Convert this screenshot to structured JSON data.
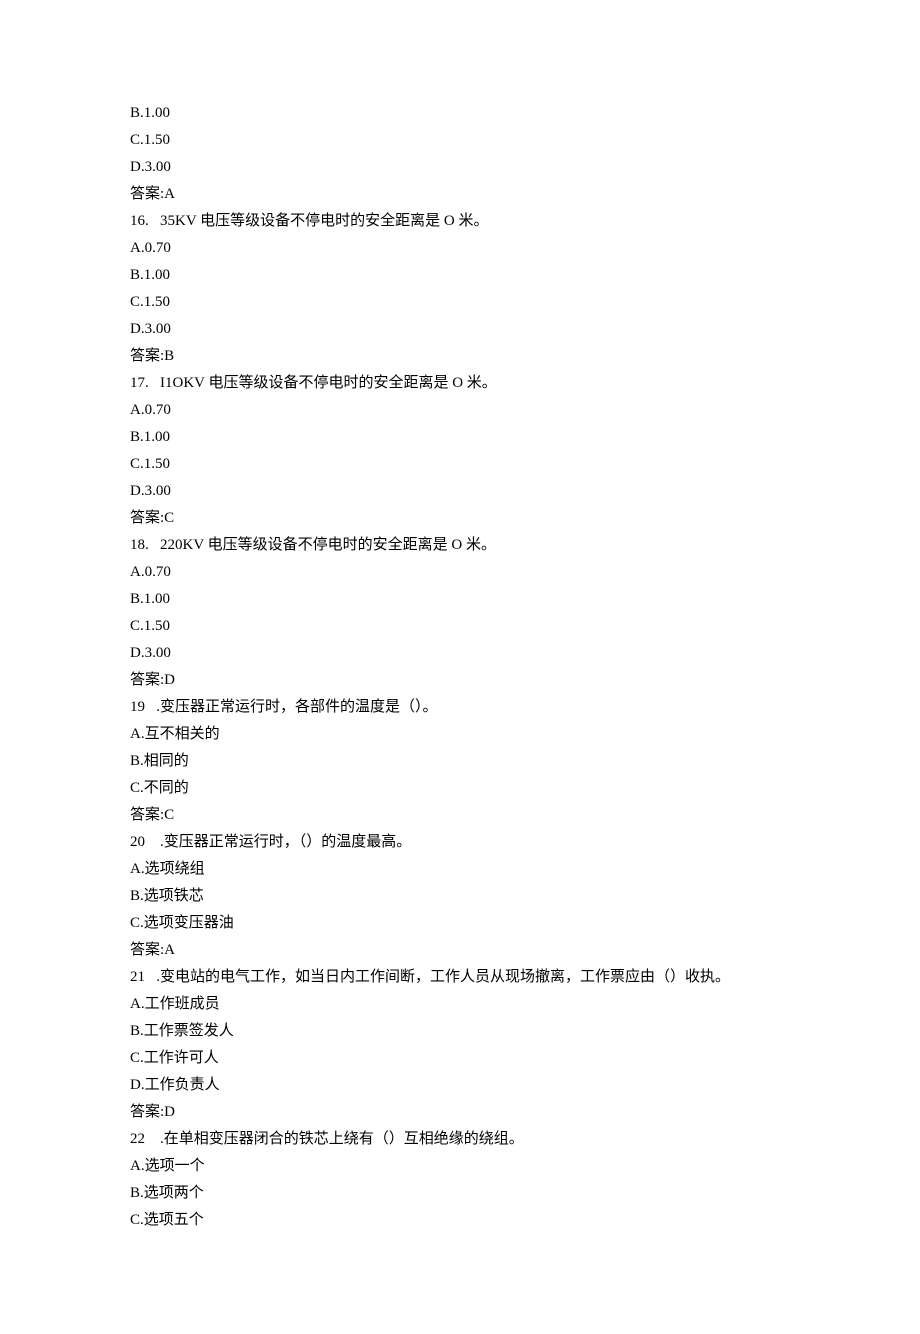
{
  "lines": [
    "B.1.00",
    "C.1.50",
    "D.3.00",
    "答案:A",
    "16.   35KV 电压等级设备不停电时的安全距离是 O 米。",
    "A.0.70",
    "B.1.00",
    "C.1.50",
    "D.3.00",
    "答案:B",
    "17.   I1OKV 电压等级设备不停电时的安全距离是 O 米。",
    "A.0.70",
    "B.1.00",
    "C.1.50",
    "D.3.00",
    "答案:C",
    "18.   220KV 电压等级设备不停电时的安全距离是 O 米。",
    "A.0.70",
    "B.1.00",
    "C.1.50",
    "D.3.00",
    "答案:D",
    "19   .变压器正常运行时，各部件的温度是（）。",
    "A.互不相关的",
    "B.相同的",
    "C.不同的",
    "答案:C",
    "20    .变压器正常运行时，（）的温度最高。",
    "A.选项绕组",
    "B.选项铁芯",
    "C.选项变压器油",
    "答案:A",
    "21   .变电站的电气工作，如当日内工作间断，工作人员从现场撤离，工作票应由（）收执。",
    "A.工作班成员",
    "B.工作票签发人",
    "C.工作许可人",
    "D.工作负责人",
    "答案:D",
    "22    .在单相变压器闭合的铁芯上绕有（）互相绝缘的绕组。",
    "A.选项一个",
    "B.选项两个",
    "C.选项五个"
  ]
}
